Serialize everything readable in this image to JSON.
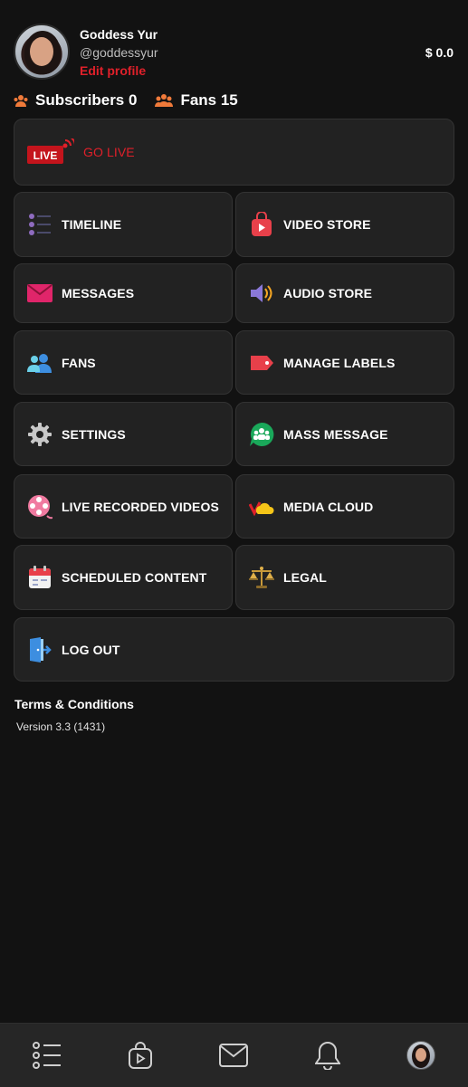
{
  "profile": {
    "name": "Goddess Yur",
    "handle": "@goddessyur",
    "edit_label": "Edit profile",
    "balance": "$ 0.0"
  },
  "stats": {
    "subscribers_label": "Subscribers 0",
    "fans_label": "Fans 15"
  },
  "menu": {
    "go_live": "GO LIVE",
    "live_badge": "LIVE",
    "timeline": "TIMELINE",
    "video_store": "VIDEO STORE",
    "messages": "MESSAGES",
    "audio_store": "AUDIO STORE",
    "fans": "FANS",
    "manage_labels": "MANAGE LABELS",
    "settings": "SETTINGS",
    "mass_message": "MASS MESSAGE",
    "live_recorded_videos": "LIVE RECORDED VIDEOS",
    "media_cloud": "MEDIA CLOUD",
    "scheduled_content": "SCHEDULED CONTENT",
    "legal": "LEGAL",
    "log_out": "LOG OUT"
  },
  "footer": {
    "terms": "Terms & Conditions",
    "version": "Version 3.3 (1431)"
  },
  "bottom_nav": [
    "list-icon",
    "video-bag-icon",
    "mail-icon",
    "bell-icon",
    "profile-avatar"
  ],
  "colors": {
    "background": "#121212",
    "card": "#222222",
    "accent_red": "#e0202a",
    "stat_orange": "#f07a3a"
  }
}
